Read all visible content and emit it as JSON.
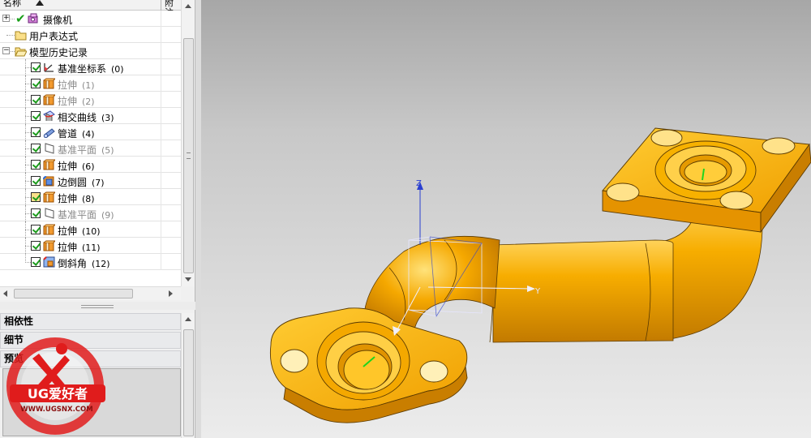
{
  "navigator": {
    "columns": {
      "name": "名称",
      "note": "附注"
    },
    "nodes": {
      "camera": "摄像机",
      "user_expressions": "用户表达式",
      "model_history": "模型历史记录"
    },
    "features": [
      {
        "label": "基准坐标系",
        "index": "(0)",
        "dimmed": false,
        "icon": "datum-csys-icon"
      },
      {
        "label": "拉伸",
        "index": "(1)",
        "dimmed": true,
        "icon": "extrude-icon"
      },
      {
        "label": "拉伸",
        "index": "(2)",
        "dimmed": true,
        "icon": "extrude-icon"
      },
      {
        "label": "相交曲线",
        "index": "(3)",
        "dimmed": false,
        "icon": "intersection-curve-icon"
      },
      {
        "label": "管道",
        "index": "(4)",
        "dimmed": false,
        "icon": "tube-icon"
      },
      {
        "label": "基准平面",
        "index": "(5)",
        "dimmed": true,
        "icon": "datum-plane-icon"
      },
      {
        "label": "拉伸",
        "index": "(6)",
        "dimmed": false,
        "icon": "extrude-icon"
      },
      {
        "label": "边倒圆",
        "index": "(7)",
        "dimmed": false,
        "icon": "edge-blend-icon"
      },
      {
        "label": "拉伸",
        "index": "(8)",
        "dimmed": false,
        "icon": "extrude-icon"
      },
      {
        "label": "基准平面",
        "index": "(9)",
        "dimmed": true,
        "icon": "datum-plane-icon"
      },
      {
        "label": "拉伸",
        "index": "(10)",
        "dimmed": false,
        "icon": "extrude-icon"
      },
      {
        "label": "拉伸",
        "index": "(11)",
        "dimmed": false,
        "icon": "extrude-icon"
      },
      {
        "label": "倒斜角",
        "index": "(12)",
        "dimmed": false,
        "icon": "chamfer-icon"
      }
    ],
    "panels": {
      "dependencies": "相依性",
      "details": "细节",
      "preview": "预览"
    }
  },
  "viewport": {
    "axis_labels": {
      "z": "Z",
      "y": "Y"
    },
    "model_color": "#f5a800",
    "axis_colors": {
      "z": "#2a3fd0",
      "y": "#e8e8ff",
      "x_normal": "#3ac83a"
    }
  },
  "watermark": {
    "brand": "UG爱好者",
    "url": "WWW.UGSNX.COM"
  }
}
